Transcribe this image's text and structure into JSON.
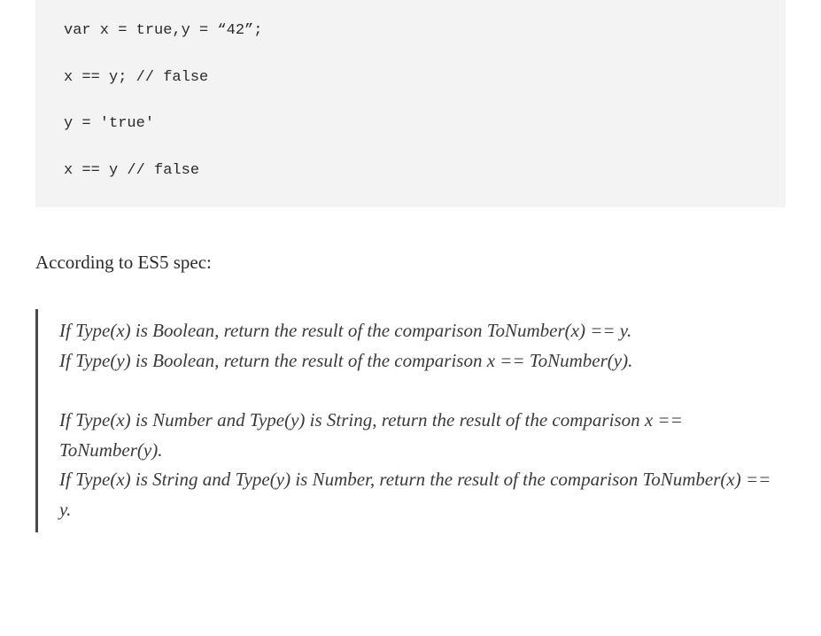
{
  "code": {
    "lines": [
      "var x = true,y = “42”;",
      "",
      "x == y; // false",
      "",
      "y = 'true'",
      "",
      "x == y // false"
    ]
  },
  "intro": "According to ES5 spec:",
  "quote": {
    "p1": "If Type(x) is Boolean, return the result of the comparison ToNumber(x) == y.",
    "p2": "If Type(y) is Boolean, return the result of the comparison x == ToNumber(y).",
    "p3": "If Type(x) is Number and Type(y) is String, return the result of the comparison x == ToNumber(y).",
    "p4": "If Type(x) is String and Type(y) is Number, return the result of the comparison ToNumber(x) == y."
  }
}
